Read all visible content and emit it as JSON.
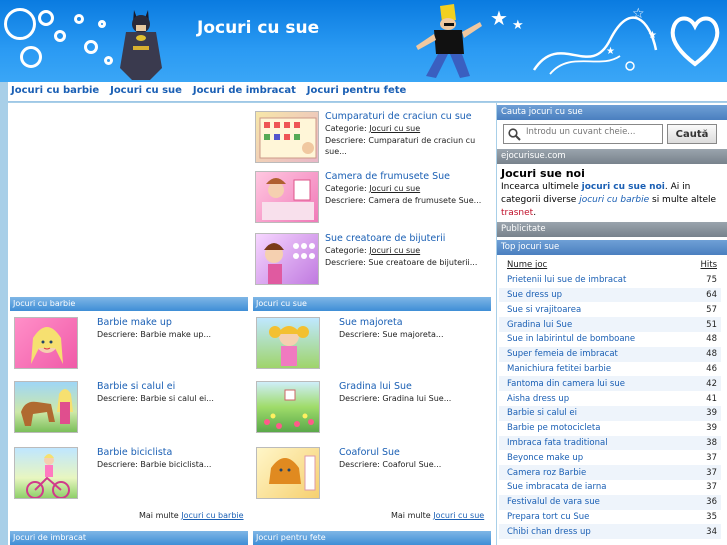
{
  "header": {
    "title": "Jocuri cu sue"
  },
  "nav": [
    "Jocuri cu barbie",
    "Jocuri cu sue",
    "Jocuri de imbracat",
    "Jocuri pentru fete"
  ],
  "featured": [
    {
      "title": "Cumparaturi de craciun cu sue",
      "cat_label": "Categorie:",
      "cat": "Jocuri cu sue",
      "desc": "Descriere: Cumparaturi de craciun cu sue..."
    },
    {
      "title": "Camera de frumusete Sue",
      "cat_label": "Categorie:",
      "cat": "Jocuri cu sue",
      "desc": "Descriere: Camera de frumusete Sue..."
    },
    {
      "title": "Sue creatoare de bijuterii",
      "cat_label": "Categorie:",
      "cat": "Jocuri cu sue",
      "desc": "Descriere: Sue creatoare de bijuterii..."
    }
  ],
  "sections": {
    "barbie": {
      "title": "Jocuri cu barbie",
      "items": [
        {
          "title": "Barbie make up",
          "desc": "Descriere: Barbie make up..."
        },
        {
          "title": "Barbie si calul ei",
          "desc": "Descriere: Barbie si calul ei..."
        },
        {
          "title": "Barbie biciclista",
          "desc": "Descriere: Barbie biciclista..."
        }
      ],
      "more_prefix": "Mai multe",
      "more_link": "Jocuri cu barbie"
    },
    "sue": {
      "title": "Jocuri cu sue",
      "items": [
        {
          "title": "Sue majoreta",
          "desc": "Descriere: Sue majoreta..."
        },
        {
          "title": "Gradina lui Sue",
          "desc": "Descriere: Gradina lui Sue..."
        },
        {
          "title": "Coaforul Sue",
          "desc": "Descriere: Coaforul Sue..."
        }
      ],
      "more_prefix": "Mai multe",
      "more_link": "Jocuri cu sue"
    },
    "imbracat": {
      "title": "Jocuri de imbracat"
    },
    "fete": {
      "title": "Jocuri pentru fete"
    }
  },
  "sidebar": {
    "search_title": "Cauta jocuri cu sue",
    "search_placeholder": "Introdu un cuvant cheie...",
    "search_button": "Caută",
    "site_bar": "ejocurisue.com",
    "intro_title": "Jocuri sue noi",
    "intro_p1": "Incearca ultimele",
    "intro_kw": "jocuri cu sue noi",
    "intro_p2": ". Ai in categorii diverse",
    "intro_it": "jocuri cu barbie",
    "intro_p3": "si multe altele",
    "intro_red": "trasnet",
    "intro_end": ".",
    "ads_bar": "Publicitate",
    "top_bar": "Top jocuri sue",
    "top_headers": [
      "Nume joc",
      "Hits"
    ],
    "top": [
      [
        "Prietenii lui sue de imbracat",
        "75"
      ],
      [
        "Sue dress up",
        "64"
      ],
      [
        "Sue si vrajitoarea",
        "57"
      ],
      [
        "Gradina lui Sue",
        "51"
      ],
      [
        "Sue in labirintul de bomboane",
        "48"
      ],
      [
        "Super femeia de imbracat",
        "48"
      ],
      [
        "Manichiura fetitei barbie",
        "46"
      ],
      [
        "Fantoma din camera lui sue",
        "42"
      ],
      [
        "Aisha dress up",
        "41"
      ],
      [
        "Barbie si calul ei",
        "39"
      ],
      [
        "Barbie pe motocicleta",
        "39"
      ],
      [
        "Imbraca fata traditional",
        "38"
      ],
      [
        "Beyonce make up",
        "37"
      ],
      [
        "Camera roz Barbie",
        "37"
      ],
      [
        "Sue imbracata de iarna",
        "37"
      ],
      [
        "Festivalul de vara sue",
        "36"
      ],
      [
        "Prepara tort cu Sue",
        "35"
      ],
      [
        "Chibi chan dress up",
        "34"
      ]
    ]
  }
}
